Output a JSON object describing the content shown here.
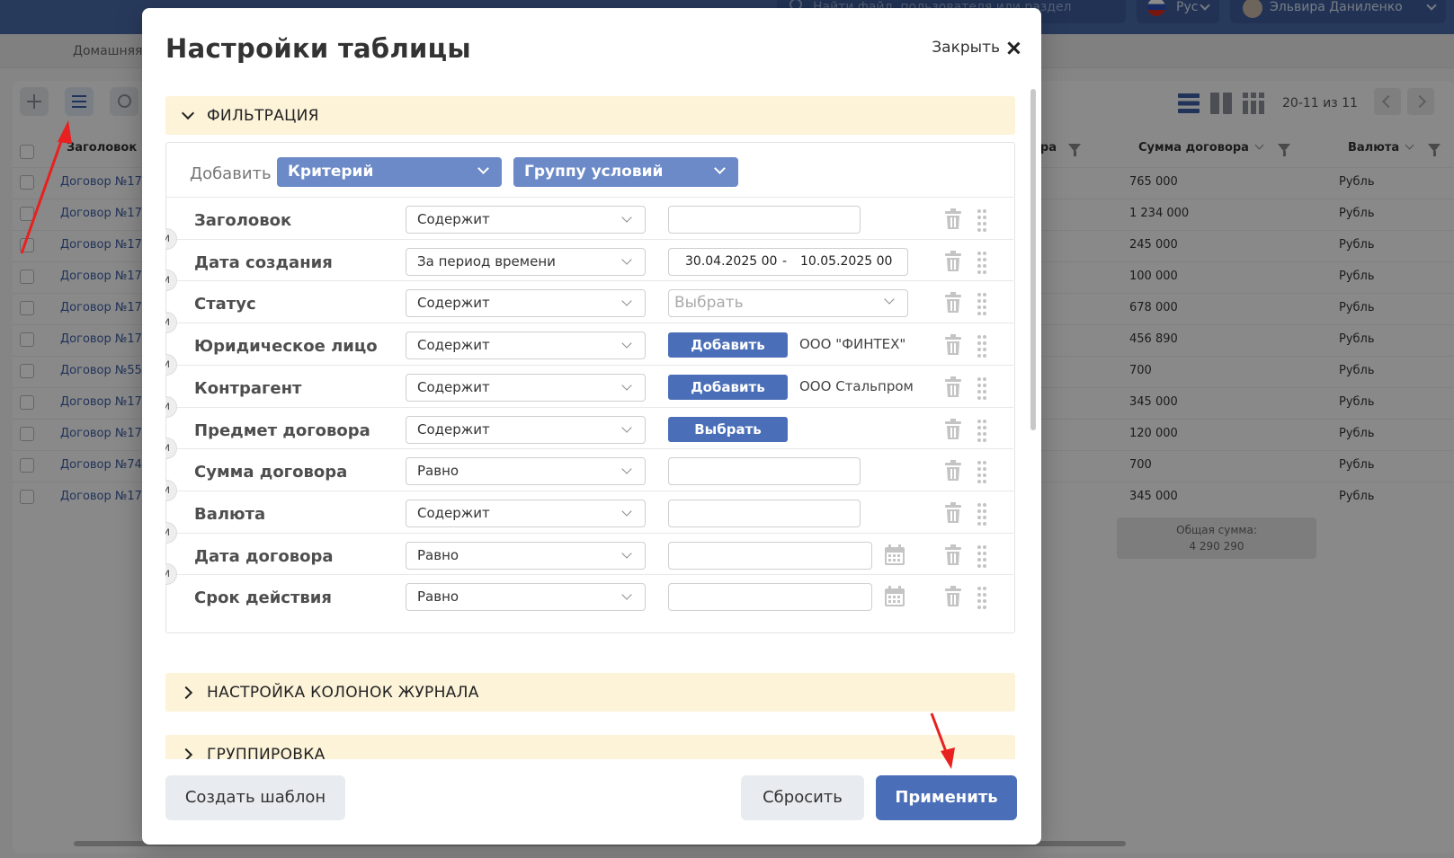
{
  "app": {
    "search_placeholder": "Найти файл, пользователя или раздел",
    "language": "Рус",
    "user_name": "Эльвира Даниленко",
    "breadcrumb": "Домашняя"
  },
  "background_table": {
    "pager": "20-11 из 11",
    "columns": [
      "Заголовок",
      "ора",
      "Сумма договора",
      "Валюта"
    ],
    "rows": [
      {
        "title": "Договор №17",
        "amount": "765 000",
        "currency": "Рубль"
      },
      {
        "title": "Договор №17",
        "amount": "1 234 000",
        "currency": "Рубль"
      },
      {
        "title": "Договор №17",
        "amount": "245 000",
        "currency": "Рубль"
      },
      {
        "title": "Договор №17",
        "amount": "100 000",
        "currency": "Рубль"
      },
      {
        "title": "Договор №17",
        "amount": "678 000",
        "currency": "Рубль"
      },
      {
        "title": "Договор №17",
        "amount": "456 890",
        "currency": "Рубль"
      },
      {
        "title": "Договор №55",
        "amount": "700",
        "currency": "Рубль"
      },
      {
        "title": "Договор №17",
        "amount": "345 000",
        "currency": "Рубль"
      },
      {
        "title": "Договор №17",
        "amount": "120 000",
        "currency": "Рубль"
      },
      {
        "title": "Договор №74",
        "amount": "700",
        "currency": "Рубль"
      },
      {
        "title": "Договор №17",
        "amount": "345 000",
        "currency": "Рубль"
      }
    ],
    "total_label": "Общая сумма:",
    "total_value": "4 290 290"
  },
  "modal": {
    "title": "Настройки таблицы",
    "close_label": "Закрыть",
    "sections": {
      "filter": "ФИЛЬТРАЦИЯ",
      "columns": "НАСТРОЙКА КОЛОНОК ЖУРНАЛА",
      "grouping": "ГРУППИРОВКА"
    },
    "add_label": "Добавить",
    "add_criterion": "Критерий",
    "add_group": "Группу условий",
    "and_label": "и",
    "filters": [
      {
        "label": "Заголовок",
        "operator": "Содержит"
      },
      {
        "label": "Дата создания",
        "operator": "За период времени",
        "date_from": "30.04.2025 00",
        "date_sep": "-",
        "date_to": "10.05.2025 00"
      },
      {
        "label": "Статус",
        "operator": "Содержит",
        "placeholder": "Выбрать"
      },
      {
        "label": "Юридическое лицо",
        "operator": "Содержит",
        "button": "Добавить",
        "value": "ООО \"ФИНТЕХ\""
      },
      {
        "label": "Контрагент",
        "operator": "Содержит",
        "button": "Добавить",
        "value": "ООО Стальпром"
      },
      {
        "label": "Предмет договора",
        "operator": "Содержит",
        "button": "Выбрать"
      },
      {
        "label": "Сумма договора",
        "operator": "Равно"
      },
      {
        "label": "Валюта",
        "operator": "Содержит"
      },
      {
        "label": "Дата договора",
        "operator": "Равно"
      },
      {
        "label": "Срок действия",
        "operator": "Равно"
      }
    ],
    "buttons": {
      "create_template": "Создать шаблон",
      "reset": "Сбросить",
      "apply": "Применить"
    }
  },
  "colors": {
    "primary": "#4a6fb8",
    "section_bg": "#fcf3d9",
    "annotation_arrow": "#e8201f"
  }
}
